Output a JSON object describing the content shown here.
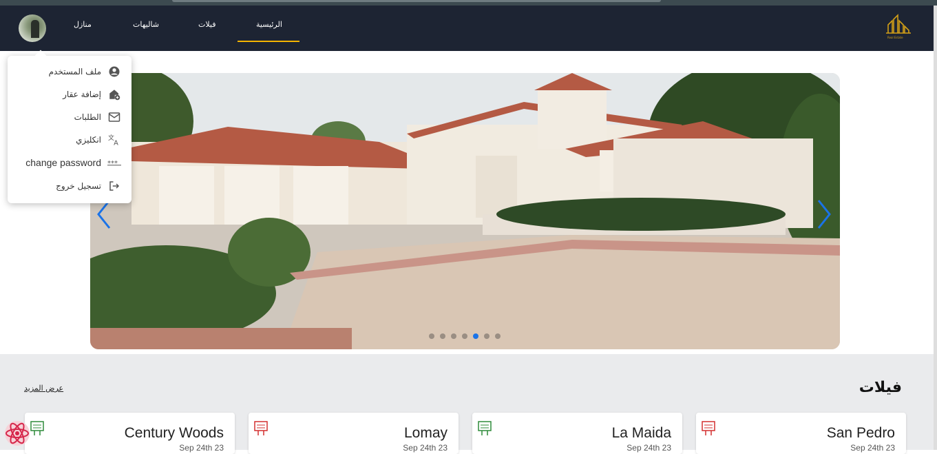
{
  "nav": {
    "links": [
      "الرئيسية",
      "فيلات",
      "شاليهات",
      "منازل"
    ],
    "active_index": 0,
    "logo_text": "Real Estate",
    "accent_color": "#f4b400"
  },
  "user_menu": {
    "items": [
      {
        "label": "ملف المستخدم",
        "icon": "account-circle-icon"
      },
      {
        "label": "إضافة عقار",
        "icon": "add-home-icon"
      },
      {
        "label": "الطلبات",
        "icon": "mail-icon"
      },
      {
        "label": "انكليزي",
        "icon": "translate-icon"
      },
      {
        "label": "change password",
        "icon": "password-icon"
      },
      {
        "label": "تسجيل خروج",
        "icon": "logout-icon"
      }
    ]
  },
  "carousel": {
    "slide_count": 7,
    "active_slide": 5,
    "dot_active_color": "#1a73e8"
  },
  "section": {
    "title": "فيلات",
    "more_link": "عرض المزيد"
  },
  "cards": [
    {
      "name": "Century Woods",
      "date": "Sep 24th 23",
      "sign": "for-rent-sign-icon",
      "sign_color": "#2e8b3a"
    },
    {
      "name": "Lomay",
      "date": "Sep 24th 23",
      "sign": "for-sale-sign-icon",
      "sign_color": "#d32f2f"
    },
    {
      "name": "La Maida",
      "date": "Sep 24th 23",
      "sign": "for-rent-sign-icon",
      "sign_color": "#2e8b3a"
    },
    {
      "name": "San Pedro",
      "date": "Sep 24th 23",
      "sign": "for-sale-sign-icon",
      "sign_color": "#d32f2f"
    }
  ]
}
